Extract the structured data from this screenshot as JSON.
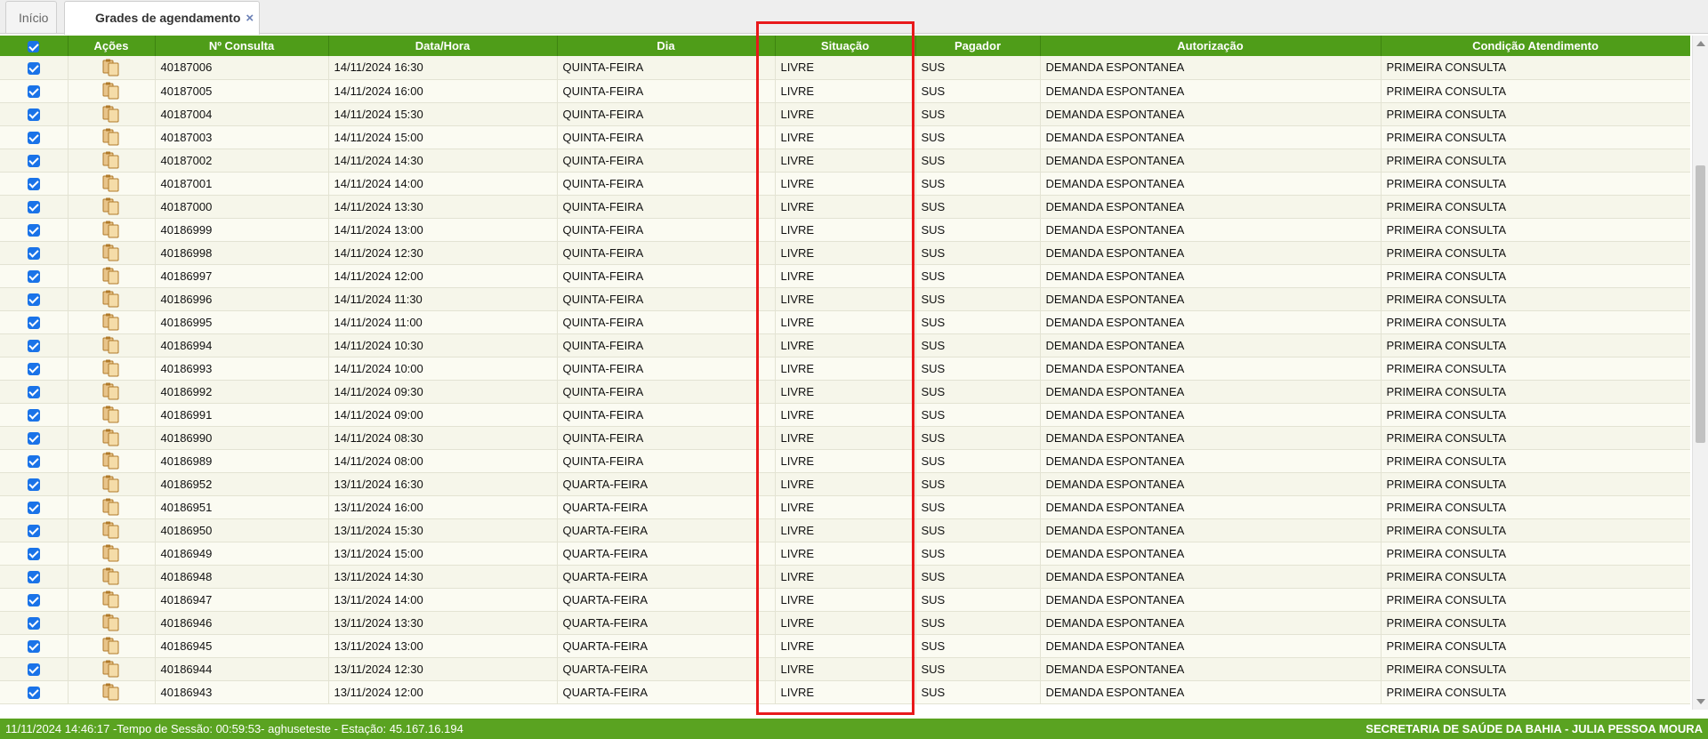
{
  "tabs": [
    {
      "label": "Início",
      "active": false
    },
    {
      "label": "Grades de agendamento",
      "active": true,
      "close": "×"
    }
  ],
  "table": {
    "headers": [
      "Ações",
      "Nº Consulta",
      "Data/Hora",
      "Dia",
      "Situação",
      "Pagador",
      "Autorização",
      "Condição Atendimento"
    ],
    "rows": [
      {
        "id": "40187006",
        "datetime": "14/11/2024 16:30",
        "day": "QUINTA-FEIRA",
        "status": "LIVRE",
        "payer": "SUS",
        "authorization": "DEMANDA ESPONTANEA",
        "condition": "PRIMEIRA CONSULTA"
      },
      {
        "id": "40187005",
        "datetime": "14/11/2024 16:00",
        "day": "QUINTA-FEIRA",
        "status": "LIVRE",
        "payer": "SUS",
        "authorization": "DEMANDA ESPONTANEA",
        "condition": "PRIMEIRA CONSULTA"
      },
      {
        "id": "40187004",
        "datetime": "14/11/2024 15:30",
        "day": "QUINTA-FEIRA",
        "status": "LIVRE",
        "payer": "SUS",
        "authorization": "DEMANDA ESPONTANEA",
        "condition": "PRIMEIRA CONSULTA"
      },
      {
        "id": "40187003",
        "datetime": "14/11/2024 15:00",
        "day": "QUINTA-FEIRA",
        "status": "LIVRE",
        "payer": "SUS",
        "authorization": "DEMANDA ESPONTANEA",
        "condition": "PRIMEIRA CONSULTA"
      },
      {
        "id": "40187002",
        "datetime": "14/11/2024 14:30",
        "day": "QUINTA-FEIRA",
        "status": "LIVRE",
        "payer": "SUS",
        "authorization": "DEMANDA ESPONTANEA",
        "condition": "PRIMEIRA CONSULTA"
      },
      {
        "id": "40187001",
        "datetime": "14/11/2024 14:00",
        "day": "QUINTA-FEIRA",
        "status": "LIVRE",
        "payer": "SUS",
        "authorization": "DEMANDA ESPONTANEA",
        "condition": "PRIMEIRA CONSULTA"
      },
      {
        "id": "40187000",
        "datetime": "14/11/2024 13:30",
        "day": "QUINTA-FEIRA",
        "status": "LIVRE",
        "payer": "SUS",
        "authorization": "DEMANDA ESPONTANEA",
        "condition": "PRIMEIRA CONSULTA"
      },
      {
        "id": "40186999",
        "datetime": "14/11/2024 13:00",
        "day": "QUINTA-FEIRA",
        "status": "LIVRE",
        "payer": "SUS",
        "authorization": "DEMANDA ESPONTANEA",
        "condition": "PRIMEIRA CONSULTA"
      },
      {
        "id": "40186998",
        "datetime": "14/11/2024 12:30",
        "day": "QUINTA-FEIRA",
        "status": "LIVRE",
        "payer": "SUS",
        "authorization": "DEMANDA ESPONTANEA",
        "condition": "PRIMEIRA CONSULTA"
      },
      {
        "id": "40186997",
        "datetime": "14/11/2024 12:00",
        "day": "QUINTA-FEIRA",
        "status": "LIVRE",
        "payer": "SUS",
        "authorization": "DEMANDA ESPONTANEA",
        "condition": "PRIMEIRA CONSULTA"
      },
      {
        "id": "40186996",
        "datetime": "14/11/2024 11:30",
        "day": "QUINTA-FEIRA",
        "status": "LIVRE",
        "payer": "SUS",
        "authorization": "DEMANDA ESPONTANEA",
        "condition": "PRIMEIRA CONSULTA"
      },
      {
        "id": "40186995",
        "datetime": "14/11/2024 11:00",
        "day": "QUINTA-FEIRA",
        "status": "LIVRE",
        "payer": "SUS",
        "authorization": "DEMANDA ESPONTANEA",
        "condition": "PRIMEIRA CONSULTA"
      },
      {
        "id": "40186994",
        "datetime": "14/11/2024 10:30",
        "day": "QUINTA-FEIRA",
        "status": "LIVRE",
        "payer": "SUS",
        "authorization": "DEMANDA ESPONTANEA",
        "condition": "PRIMEIRA CONSULTA"
      },
      {
        "id": "40186993",
        "datetime": "14/11/2024 10:00",
        "day": "QUINTA-FEIRA",
        "status": "LIVRE",
        "payer": "SUS",
        "authorization": "DEMANDA ESPONTANEA",
        "condition": "PRIMEIRA CONSULTA"
      },
      {
        "id": "40186992",
        "datetime": "14/11/2024 09:30",
        "day": "QUINTA-FEIRA",
        "status": "LIVRE",
        "payer": "SUS",
        "authorization": "DEMANDA ESPONTANEA",
        "condition": "PRIMEIRA CONSULTA"
      },
      {
        "id": "40186991",
        "datetime": "14/11/2024 09:00",
        "day": "QUINTA-FEIRA",
        "status": "LIVRE",
        "payer": "SUS",
        "authorization": "DEMANDA ESPONTANEA",
        "condition": "PRIMEIRA CONSULTA"
      },
      {
        "id": "40186990",
        "datetime": "14/11/2024 08:30",
        "day": "QUINTA-FEIRA",
        "status": "LIVRE",
        "payer": "SUS",
        "authorization": "DEMANDA ESPONTANEA",
        "condition": "PRIMEIRA CONSULTA"
      },
      {
        "id": "40186989",
        "datetime": "14/11/2024 08:00",
        "day": "QUINTA-FEIRA",
        "status": "LIVRE",
        "payer": "SUS",
        "authorization": "DEMANDA ESPONTANEA",
        "condition": "PRIMEIRA CONSULTA"
      },
      {
        "id": "40186952",
        "datetime": "13/11/2024 16:30",
        "day": "QUARTA-FEIRA",
        "status": "LIVRE",
        "payer": "SUS",
        "authorization": "DEMANDA ESPONTANEA",
        "condition": "PRIMEIRA CONSULTA"
      },
      {
        "id": "40186951",
        "datetime": "13/11/2024 16:00",
        "day": "QUARTA-FEIRA",
        "status": "LIVRE",
        "payer": "SUS",
        "authorization": "DEMANDA ESPONTANEA",
        "condition": "PRIMEIRA CONSULTA"
      },
      {
        "id": "40186950",
        "datetime": "13/11/2024 15:30",
        "day": "QUARTA-FEIRA",
        "status": "LIVRE",
        "payer": "SUS",
        "authorization": "DEMANDA ESPONTANEA",
        "condition": "PRIMEIRA CONSULTA"
      },
      {
        "id": "40186949",
        "datetime": "13/11/2024 15:00",
        "day": "QUARTA-FEIRA",
        "status": "LIVRE",
        "payer": "SUS",
        "authorization": "DEMANDA ESPONTANEA",
        "condition": "PRIMEIRA CONSULTA"
      },
      {
        "id": "40186948",
        "datetime": "13/11/2024 14:30",
        "day": "QUARTA-FEIRA",
        "status": "LIVRE",
        "payer": "SUS",
        "authorization": "DEMANDA ESPONTANEA",
        "condition": "PRIMEIRA CONSULTA"
      },
      {
        "id": "40186947",
        "datetime": "13/11/2024 14:00",
        "day": "QUARTA-FEIRA",
        "status": "LIVRE",
        "payer": "SUS",
        "authorization": "DEMANDA ESPONTANEA",
        "condition": "PRIMEIRA CONSULTA"
      },
      {
        "id": "40186946",
        "datetime": "13/11/2024 13:30",
        "day": "QUARTA-FEIRA",
        "status": "LIVRE",
        "payer": "SUS",
        "authorization": "DEMANDA ESPONTANEA",
        "condition": "PRIMEIRA CONSULTA"
      },
      {
        "id": "40186945",
        "datetime": "13/11/2024 13:00",
        "day": "QUARTA-FEIRA",
        "status": "LIVRE",
        "payer": "SUS",
        "authorization": "DEMANDA ESPONTANEA",
        "condition": "PRIMEIRA CONSULTA"
      },
      {
        "id": "40186944",
        "datetime": "13/11/2024 12:30",
        "day": "QUARTA-FEIRA",
        "status": "LIVRE",
        "payer": "SUS",
        "authorization": "DEMANDA ESPONTANEA",
        "condition": "PRIMEIRA CONSULTA"
      },
      {
        "id": "40186943",
        "datetime": "13/11/2024 12:00",
        "day": "QUARTA-FEIRA",
        "status": "LIVRE",
        "payer": "SUS",
        "authorization": "DEMANDA ESPONTANEA",
        "condition": "PRIMEIRA CONSULTA"
      }
    ]
  },
  "statusbar": {
    "left": "11/11/2024 14:46:17 -Tempo de Sessão: 00:59:53- aghuseteste - Estação: 45.167.16.194",
    "right": "SECRETARIA DE SAÚDE DA BAHIA - JULIA PESSOA MOURA"
  },
  "colors": {
    "header_green": "#4f9d19",
    "status_green": "#5aa321",
    "highlight": "#e8191b",
    "checkbox": "#1a73e8"
  },
  "icons": {
    "row_action": "documents-icon",
    "tab_close": "close-icon"
  }
}
